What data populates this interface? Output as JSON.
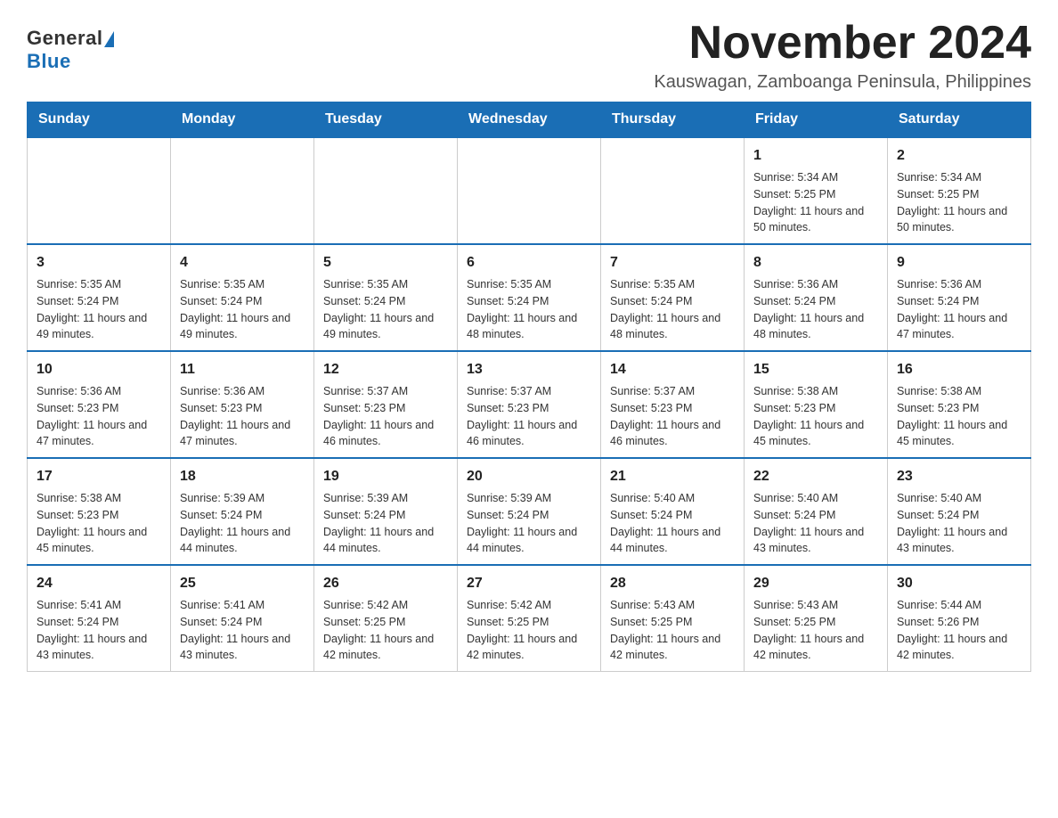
{
  "header": {
    "logo_general": "General",
    "logo_blue": "Blue",
    "month_title": "November 2024",
    "location": "Kauswagan, Zamboanga Peninsula, Philippines"
  },
  "weekdays": [
    "Sunday",
    "Monday",
    "Tuesday",
    "Wednesday",
    "Thursday",
    "Friday",
    "Saturday"
  ],
  "weeks": [
    [
      {
        "day": "",
        "info": ""
      },
      {
        "day": "",
        "info": ""
      },
      {
        "day": "",
        "info": ""
      },
      {
        "day": "",
        "info": ""
      },
      {
        "day": "",
        "info": ""
      },
      {
        "day": "1",
        "info": "Sunrise: 5:34 AM\nSunset: 5:25 PM\nDaylight: 11 hours and 50 minutes."
      },
      {
        "day": "2",
        "info": "Sunrise: 5:34 AM\nSunset: 5:25 PM\nDaylight: 11 hours and 50 minutes."
      }
    ],
    [
      {
        "day": "3",
        "info": "Sunrise: 5:35 AM\nSunset: 5:24 PM\nDaylight: 11 hours and 49 minutes."
      },
      {
        "day": "4",
        "info": "Sunrise: 5:35 AM\nSunset: 5:24 PM\nDaylight: 11 hours and 49 minutes."
      },
      {
        "day": "5",
        "info": "Sunrise: 5:35 AM\nSunset: 5:24 PM\nDaylight: 11 hours and 49 minutes."
      },
      {
        "day": "6",
        "info": "Sunrise: 5:35 AM\nSunset: 5:24 PM\nDaylight: 11 hours and 48 minutes."
      },
      {
        "day": "7",
        "info": "Sunrise: 5:35 AM\nSunset: 5:24 PM\nDaylight: 11 hours and 48 minutes."
      },
      {
        "day": "8",
        "info": "Sunrise: 5:36 AM\nSunset: 5:24 PM\nDaylight: 11 hours and 48 minutes."
      },
      {
        "day": "9",
        "info": "Sunrise: 5:36 AM\nSunset: 5:24 PM\nDaylight: 11 hours and 47 minutes."
      }
    ],
    [
      {
        "day": "10",
        "info": "Sunrise: 5:36 AM\nSunset: 5:23 PM\nDaylight: 11 hours and 47 minutes."
      },
      {
        "day": "11",
        "info": "Sunrise: 5:36 AM\nSunset: 5:23 PM\nDaylight: 11 hours and 47 minutes."
      },
      {
        "day": "12",
        "info": "Sunrise: 5:37 AM\nSunset: 5:23 PM\nDaylight: 11 hours and 46 minutes."
      },
      {
        "day": "13",
        "info": "Sunrise: 5:37 AM\nSunset: 5:23 PM\nDaylight: 11 hours and 46 minutes."
      },
      {
        "day": "14",
        "info": "Sunrise: 5:37 AM\nSunset: 5:23 PM\nDaylight: 11 hours and 46 minutes."
      },
      {
        "day": "15",
        "info": "Sunrise: 5:38 AM\nSunset: 5:23 PM\nDaylight: 11 hours and 45 minutes."
      },
      {
        "day": "16",
        "info": "Sunrise: 5:38 AM\nSunset: 5:23 PM\nDaylight: 11 hours and 45 minutes."
      }
    ],
    [
      {
        "day": "17",
        "info": "Sunrise: 5:38 AM\nSunset: 5:23 PM\nDaylight: 11 hours and 45 minutes."
      },
      {
        "day": "18",
        "info": "Sunrise: 5:39 AM\nSunset: 5:24 PM\nDaylight: 11 hours and 44 minutes."
      },
      {
        "day": "19",
        "info": "Sunrise: 5:39 AM\nSunset: 5:24 PM\nDaylight: 11 hours and 44 minutes."
      },
      {
        "day": "20",
        "info": "Sunrise: 5:39 AM\nSunset: 5:24 PM\nDaylight: 11 hours and 44 minutes."
      },
      {
        "day": "21",
        "info": "Sunrise: 5:40 AM\nSunset: 5:24 PM\nDaylight: 11 hours and 44 minutes."
      },
      {
        "day": "22",
        "info": "Sunrise: 5:40 AM\nSunset: 5:24 PM\nDaylight: 11 hours and 43 minutes."
      },
      {
        "day": "23",
        "info": "Sunrise: 5:40 AM\nSunset: 5:24 PM\nDaylight: 11 hours and 43 minutes."
      }
    ],
    [
      {
        "day": "24",
        "info": "Sunrise: 5:41 AM\nSunset: 5:24 PM\nDaylight: 11 hours and 43 minutes."
      },
      {
        "day": "25",
        "info": "Sunrise: 5:41 AM\nSunset: 5:24 PM\nDaylight: 11 hours and 43 minutes."
      },
      {
        "day": "26",
        "info": "Sunrise: 5:42 AM\nSunset: 5:25 PM\nDaylight: 11 hours and 42 minutes."
      },
      {
        "day": "27",
        "info": "Sunrise: 5:42 AM\nSunset: 5:25 PM\nDaylight: 11 hours and 42 minutes."
      },
      {
        "day": "28",
        "info": "Sunrise: 5:43 AM\nSunset: 5:25 PM\nDaylight: 11 hours and 42 minutes."
      },
      {
        "day": "29",
        "info": "Sunrise: 5:43 AM\nSunset: 5:25 PM\nDaylight: 11 hours and 42 minutes."
      },
      {
        "day": "30",
        "info": "Sunrise: 5:44 AM\nSunset: 5:26 PM\nDaylight: 11 hours and 42 minutes."
      }
    ]
  ]
}
